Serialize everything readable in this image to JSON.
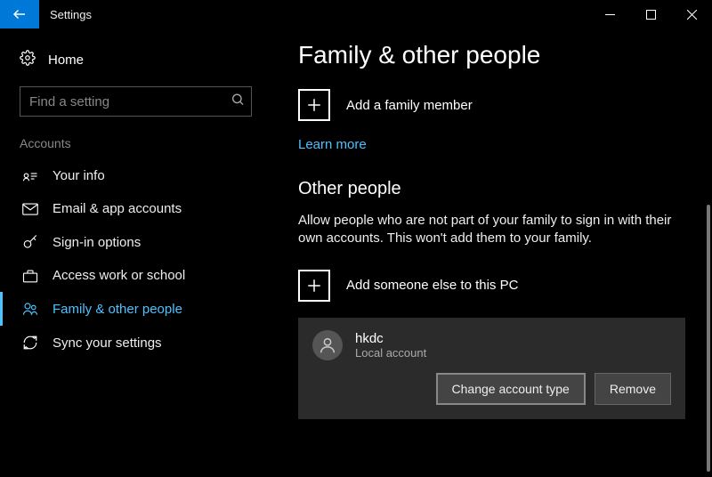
{
  "titlebar": {
    "title": "Settings"
  },
  "sidebar": {
    "home_label": "Home",
    "search_placeholder": "Find a setting",
    "section_label": "Accounts",
    "items": [
      {
        "label": "Your info"
      },
      {
        "label": "Email & app accounts"
      },
      {
        "label": "Sign-in options"
      },
      {
        "label": "Access work or school"
      },
      {
        "label": "Family & other people"
      },
      {
        "label": "Sync your settings"
      }
    ]
  },
  "content": {
    "heading": "Family & other people",
    "add_family_label": "Add a family member",
    "learn_more": "Learn more",
    "other_heading": "Other people",
    "other_desc": "Allow people who are not part of your family to sign in with their own accounts. This won't add them to your family.",
    "add_other_label": "Add someone else to this PC",
    "user": {
      "name": "hkdc",
      "subtitle": "Local account",
      "change_btn": "Change account type",
      "remove_btn": "Remove"
    }
  }
}
